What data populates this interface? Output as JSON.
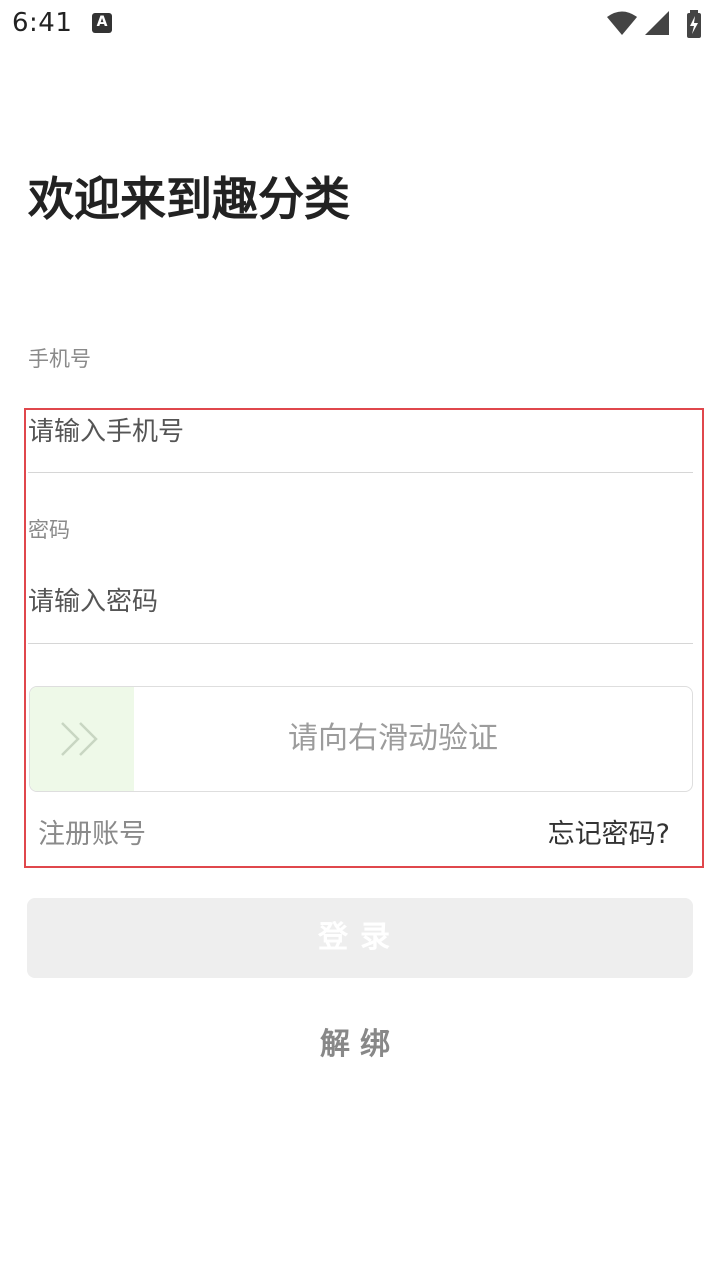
{
  "status_bar": {
    "time": "6:41",
    "notification_icon": "a-icon",
    "icons": [
      "wifi-icon",
      "signal-icon",
      "battery-icon"
    ]
  },
  "title": "欢迎来到趣分类",
  "phone": {
    "label": "手机号",
    "placeholder": "请输入手机号",
    "value": ""
  },
  "password": {
    "label": "密码",
    "placeholder": "请输入密码",
    "value": ""
  },
  "slider": {
    "text": "请向右滑动验证",
    "handle_icon": "double-chevron-right-icon",
    "progress": 0
  },
  "links": {
    "register": "注册账号",
    "forgot": "忘记密码?"
  },
  "buttons": {
    "login": "登录",
    "unbind": "解绑"
  },
  "colors": {
    "highlight_border": "#e0474c",
    "slider_handle_bg": "#eef9e8",
    "login_button_bg": "#eeeeee"
  }
}
